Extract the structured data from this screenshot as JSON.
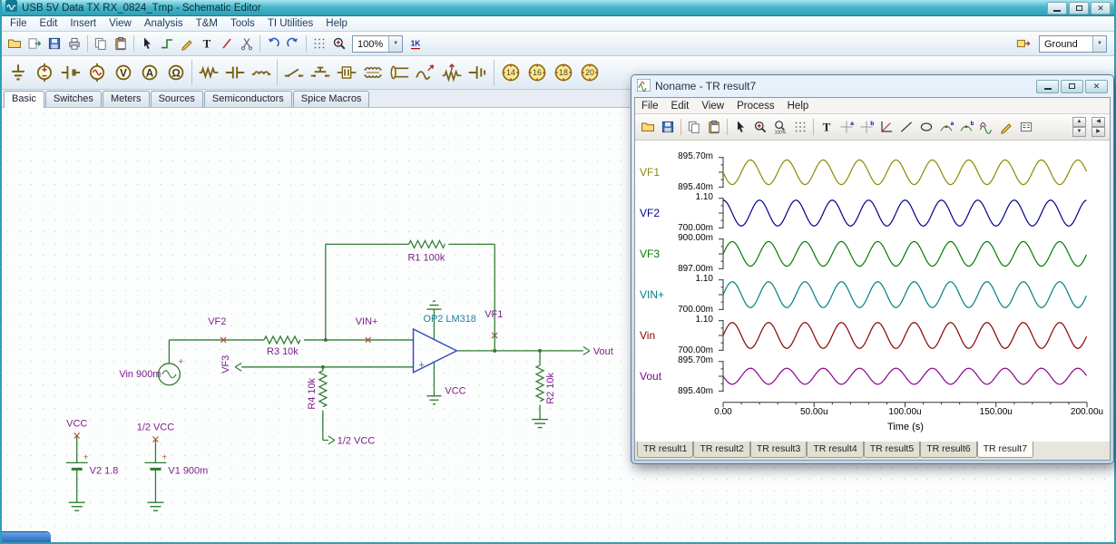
{
  "main_window": {
    "title": "USB 5V Data TX RX_0824_Tmp - Schematic Editor",
    "menu": [
      "File",
      "Edit",
      "Insert",
      "View",
      "Analysis",
      "T&M",
      "Tools",
      "TI Utilities",
      "Help"
    ],
    "toolbar": {
      "icons": [
        "open",
        "export",
        "save",
        "print",
        "sep",
        "copy",
        "paste",
        "sep",
        "select",
        "wire",
        "pen",
        "text",
        "slash",
        "cut",
        "sep",
        "undo",
        "redo",
        "sep",
        "grid",
        "zoom"
      ],
      "zoom_value": "100%",
      "icons_after_zoom": [
        "pin-1k"
      ],
      "right_icons": [
        "io-state"
      ],
      "ground_label": "Ground"
    },
    "component_toolbar": [
      "ground",
      "voltage-source",
      "battery",
      "voltage-generator",
      "voltmeter",
      "ammeter",
      "ohmmeter",
      "sep",
      "resistor",
      "capacitor",
      "inductor",
      "sep",
      "switch",
      "pushbutton",
      "relay",
      "coupled-inductor",
      "transmission-line",
      "nonlinear",
      "potentiometer",
      "terminator",
      "sep",
      "dip-14",
      "dip-16",
      "dip-18",
      "dip-20"
    ],
    "component_tabs": [
      "Basic",
      "Switches",
      "Meters",
      "Sources",
      "Semiconductors",
      "Spice Macros"
    ],
    "active_component_tab": "Basic"
  },
  "schematic": {
    "labels": {
      "vin_source": "Vin 900m",
      "vf2": "VF2",
      "r3": "R3 10k",
      "vf3": "VF3",
      "r4": "R4 10k",
      "half_vcc_r4": "1/2 VCC",
      "vin_plus": "VIN+",
      "opamp": "OP2 LM318",
      "vcc_opamp": "VCC",
      "r1": "R1 100k",
      "vf1": "VF1",
      "vout": "Vout",
      "r2": "R2 10k",
      "vcc_rail": "VCC",
      "v2": "V2 1.8",
      "half_vcc_rail": "1/2 VCC",
      "v1": "V1 900m",
      "polarity_plus": "+"
    }
  },
  "result_window": {
    "title": "Noname - TR result7",
    "menu": [
      "File",
      "Edit",
      "View",
      "Process",
      "Help"
    ],
    "toolbar_icons": [
      "open",
      "save",
      "sep",
      "copy",
      "paste",
      "sep",
      "select",
      "zoom-in",
      "zoom-100",
      "grid",
      "sep",
      "text",
      "cursor-a",
      "cursor-b",
      "axis",
      "line",
      "ellipse",
      "marker-a",
      "marker-b",
      "curves",
      "pen",
      "legend"
    ],
    "tabs": [
      "TR result1",
      "TR result2",
      "TR result3",
      "TR result4",
      "TR result5",
      "TR result6",
      "TR result7"
    ],
    "active_tab": "TR result7"
  },
  "chart_data": {
    "type": "line",
    "xlabel": "Time (s)",
    "x_ticks": [
      "0.00",
      "50.00u",
      "100.00u",
      "150.00u",
      "200.00u"
    ],
    "x_range_seconds": [
      0,
      0.0002
    ],
    "signal_shape": "sine",
    "frequency_hz": 50000,
    "cycles_shown": 10,
    "grid": false,
    "legend_position": "left",
    "panels": [
      {
        "name": "VF1",
        "y_top": "895.70m",
        "y_bottom": "895.40m",
        "color": "#8a8a00",
        "amplitude_frac": 0.4,
        "phase_deg": 180
      },
      {
        "name": "VF2",
        "y_top": "1.10",
        "y_bottom": "700.00m",
        "color": "#00008b",
        "amplitude_frac": 0.42,
        "phase_deg": 90
      },
      {
        "name": "VF3",
        "y_top": "900.00m",
        "y_bottom": "897.00m",
        "color": "#007d00",
        "amplitude_frac": 0.4,
        "phase_deg": 0
      },
      {
        "name": "VIN+",
        "y_top": "1.10",
        "y_bottom": "700.00m",
        "color": "#008080",
        "amplitude_frac": 0.42,
        "phase_deg": 0
      },
      {
        "name": "Vin",
        "y_top": "1.10",
        "y_bottom": "700.00m",
        "color": "#8b0000",
        "amplitude_frac": 0.42,
        "phase_deg": 0
      },
      {
        "name": "Vout",
        "y_top": "895.70m",
        "y_bottom": "895.40m",
        "color": "#8b008b",
        "amplitude_frac": 0.26,
        "phase_deg": 180
      }
    ]
  }
}
